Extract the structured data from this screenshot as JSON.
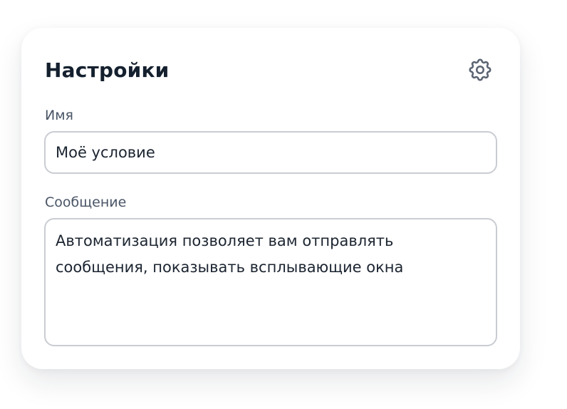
{
  "card": {
    "title": "Настройки",
    "settings_icon": "gear-icon"
  },
  "name_field": {
    "label": "Имя",
    "value": "Моё условие"
  },
  "message_field": {
    "label": "Сообщение",
    "value": "Автоматизация позволяет вам отправлять\nсообщения, показывать всплывающие окна"
  },
  "colors": {
    "title": "#14202e",
    "label": "#4a5566",
    "field_border": "#c9ccd2",
    "icon": "#5b6573"
  }
}
